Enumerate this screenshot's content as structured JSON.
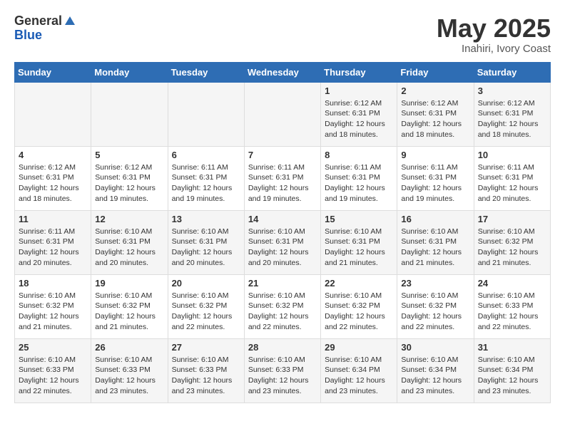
{
  "header": {
    "logo_general": "General",
    "logo_blue": "Blue",
    "month": "May 2025",
    "location": "Inahiri, Ivory Coast"
  },
  "days_of_week": [
    "Sunday",
    "Monday",
    "Tuesday",
    "Wednesday",
    "Thursday",
    "Friday",
    "Saturday"
  ],
  "weeks": [
    [
      {
        "day": "",
        "info": ""
      },
      {
        "day": "",
        "info": ""
      },
      {
        "day": "",
        "info": ""
      },
      {
        "day": "",
        "info": ""
      },
      {
        "day": "1",
        "info": "Sunrise: 6:12 AM\nSunset: 6:31 PM\nDaylight: 12 hours\nand 18 minutes."
      },
      {
        "day": "2",
        "info": "Sunrise: 6:12 AM\nSunset: 6:31 PM\nDaylight: 12 hours\nand 18 minutes."
      },
      {
        "day": "3",
        "info": "Sunrise: 6:12 AM\nSunset: 6:31 PM\nDaylight: 12 hours\nand 18 minutes."
      }
    ],
    [
      {
        "day": "4",
        "info": "Sunrise: 6:12 AM\nSunset: 6:31 PM\nDaylight: 12 hours\nand 18 minutes."
      },
      {
        "day": "5",
        "info": "Sunrise: 6:12 AM\nSunset: 6:31 PM\nDaylight: 12 hours\nand 19 minutes."
      },
      {
        "day": "6",
        "info": "Sunrise: 6:11 AM\nSunset: 6:31 PM\nDaylight: 12 hours\nand 19 minutes."
      },
      {
        "day": "7",
        "info": "Sunrise: 6:11 AM\nSunset: 6:31 PM\nDaylight: 12 hours\nand 19 minutes."
      },
      {
        "day": "8",
        "info": "Sunrise: 6:11 AM\nSunset: 6:31 PM\nDaylight: 12 hours\nand 19 minutes."
      },
      {
        "day": "9",
        "info": "Sunrise: 6:11 AM\nSunset: 6:31 PM\nDaylight: 12 hours\nand 19 minutes."
      },
      {
        "day": "10",
        "info": "Sunrise: 6:11 AM\nSunset: 6:31 PM\nDaylight: 12 hours\nand 20 minutes."
      }
    ],
    [
      {
        "day": "11",
        "info": "Sunrise: 6:11 AM\nSunset: 6:31 PM\nDaylight: 12 hours\nand 20 minutes."
      },
      {
        "day": "12",
        "info": "Sunrise: 6:10 AM\nSunset: 6:31 PM\nDaylight: 12 hours\nand 20 minutes."
      },
      {
        "day": "13",
        "info": "Sunrise: 6:10 AM\nSunset: 6:31 PM\nDaylight: 12 hours\nand 20 minutes."
      },
      {
        "day": "14",
        "info": "Sunrise: 6:10 AM\nSunset: 6:31 PM\nDaylight: 12 hours\nand 20 minutes."
      },
      {
        "day": "15",
        "info": "Sunrise: 6:10 AM\nSunset: 6:31 PM\nDaylight: 12 hours\nand 21 minutes."
      },
      {
        "day": "16",
        "info": "Sunrise: 6:10 AM\nSunset: 6:31 PM\nDaylight: 12 hours\nand 21 minutes."
      },
      {
        "day": "17",
        "info": "Sunrise: 6:10 AM\nSunset: 6:32 PM\nDaylight: 12 hours\nand 21 minutes."
      }
    ],
    [
      {
        "day": "18",
        "info": "Sunrise: 6:10 AM\nSunset: 6:32 PM\nDaylight: 12 hours\nand 21 minutes."
      },
      {
        "day": "19",
        "info": "Sunrise: 6:10 AM\nSunset: 6:32 PM\nDaylight: 12 hours\nand 21 minutes."
      },
      {
        "day": "20",
        "info": "Sunrise: 6:10 AM\nSunset: 6:32 PM\nDaylight: 12 hours\nand 22 minutes."
      },
      {
        "day": "21",
        "info": "Sunrise: 6:10 AM\nSunset: 6:32 PM\nDaylight: 12 hours\nand 22 minutes."
      },
      {
        "day": "22",
        "info": "Sunrise: 6:10 AM\nSunset: 6:32 PM\nDaylight: 12 hours\nand 22 minutes."
      },
      {
        "day": "23",
        "info": "Sunrise: 6:10 AM\nSunset: 6:32 PM\nDaylight: 12 hours\nand 22 minutes."
      },
      {
        "day": "24",
        "info": "Sunrise: 6:10 AM\nSunset: 6:33 PM\nDaylight: 12 hours\nand 22 minutes."
      }
    ],
    [
      {
        "day": "25",
        "info": "Sunrise: 6:10 AM\nSunset: 6:33 PM\nDaylight: 12 hours\nand 22 minutes."
      },
      {
        "day": "26",
        "info": "Sunrise: 6:10 AM\nSunset: 6:33 PM\nDaylight: 12 hours\nand 23 minutes."
      },
      {
        "day": "27",
        "info": "Sunrise: 6:10 AM\nSunset: 6:33 PM\nDaylight: 12 hours\nand 23 minutes."
      },
      {
        "day": "28",
        "info": "Sunrise: 6:10 AM\nSunset: 6:33 PM\nDaylight: 12 hours\nand 23 minutes."
      },
      {
        "day": "29",
        "info": "Sunrise: 6:10 AM\nSunset: 6:34 PM\nDaylight: 12 hours\nand 23 minutes."
      },
      {
        "day": "30",
        "info": "Sunrise: 6:10 AM\nSunset: 6:34 PM\nDaylight: 12 hours\nand 23 minutes."
      },
      {
        "day": "31",
        "info": "Sunrise: 6:10 AM\nSunset: 6:34 PM\nDaylight: 12 hours\nand 23 minutes."
      }
    ]
  ]
}
